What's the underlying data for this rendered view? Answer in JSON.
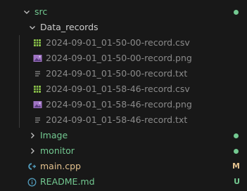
{
  "explorer": {
    "colors": {
      "background": "#181818",
      "text": "#cccccc",
      "dimmed_text": "#8b8b8b",
      "untracked_green": "#73c991",
      "modified_yellow": "#e2c08d",
      "csv_icon_green": "#8bc34a",
      "image_icon_purple": "#a074c4",
      "cpp_icon_blue": "#519aba"
    },
    "rows": [
      {
        "label": "src",
        "icon": "chevron-down-icon",
        "status": "dot"
      },
      {
        "label": "Data_records",
        "icon": "chevron-down-icon"
      },
      {
        "label": "2024-09-01_01-50-00-record.csv",
        "icon": "csv-file-icon"
      },
      {
        "label": "2024-09-01_01-50-00-record.png",
        "icon": "image-file-icon"
      },
      {
        "label": "2024-09-01_01-50-00-record.txt",
        "icon": "text-file-icon"
      },
      {
        "label": "2024-09-01_01-58-46-record.csv",
        "icon": "csv-file-icon"
      },
      {
        "label": "2024-09-01_01-58-46-record.png",
        "icon": "image-file-icon"
      },
      {
        "label": "2024-09-01_01-58-46-record.txt",
        "icon": "text-file-icon"
      },
      {
        "label": "Image",
        "icon": "chevron-right-icon",
        "status": "dot"
      },
      {
        "label": "monitor",
        "icon": "chevron-right-icon",
        "status": "dot"
      },
      {
        "label": "main.cpp",
        "icon": "cpp-file-icon",
        "badge": "M"
      },
      {
        "label": "README.md",
        "icon": "info-icon",
        "badge": "U"
      }
    ]
  }
}
